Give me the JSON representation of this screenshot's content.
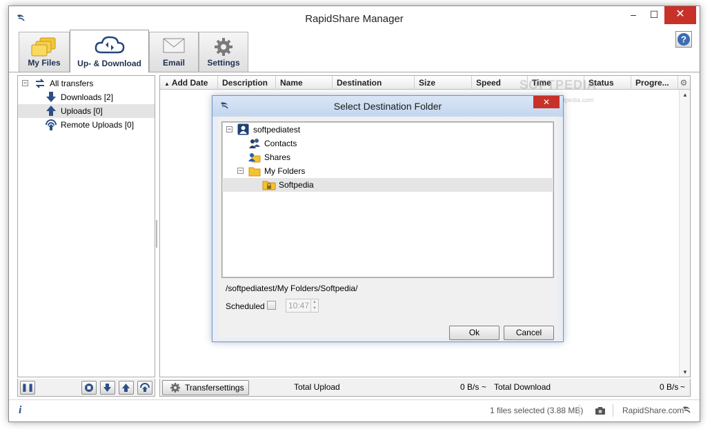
{
  "window": {
    "title": "RapidShare Manager"
  },
  "tabs": [
    {
      "label": "My Files",
      "icon": "folders-icon",
      "active": false
    },
    {
      "label": "Up- & Download",
      "icon": "cloud-sync-icon",
      "active": true
    },
    {
      "label": "Email",
      "icon": "envelope-icon",
      "active": false
    },
    {
      "label": "Settings",
      "icon": "gear-icon",
      "active": false
    }
  ],
  "help": {
    "label": "?"
  },
  "tree": {
    "root": "All transfers",
    "items": [
      "Downloads [2]",
      "Uploads [0]",
      "Remote Uploads [0]"
    ],
    "selected": "Uploads [0]"
  },
  "table": {
    "columns": [
      "Add Date",
      "Description",
      "Name",
      "Destination",
      "Size",
      "Speed",
      "Time",
      "Status",
      "Progre..."
    ],
    "sort_column": "Add Date"
  },
  "bottombar": {
    "transfer_settings": "Transfersettings",
    "total_upload_label": "Total Upload",
    "upload_speed": "0 B/s",
    "tilde1": "~",
    "total_download_label": "Total Download",
    "download_speed": "0 B/s",
    "tilde2": "~"
  },
  "statusbar": {
    "info_icon": "i",
    "selection": "1 files selected (3.88 MB)",
    "site": "RapidShare.com"
  },
  "dialog": {
    "title": "Select Destination Folder",
    "close": "✕",
    "folders": {
      "root": "softpediatest",
      "contacts": "Contacts",
      "shares": "Shares",
      "my_folders": "My Folders",
      "selected": "Softpedia"
    },
    "path": "/softpediatest/My Folders/Softpedia/",
    "scheduled_label": "Scheduled",
    "time_value": "10:47",
    "ok": "Ok",
    "cancel": "Cancel"
  },
  "watermark": {
    "text": "SOFTPEDIA",
    "url": "www.softpedia.com"
  },
  "colors": {
    "accent": "#1e2f50",
    "close_red": "#c7312a",
    "dialog_border": "#6f93c4"
  }
}
